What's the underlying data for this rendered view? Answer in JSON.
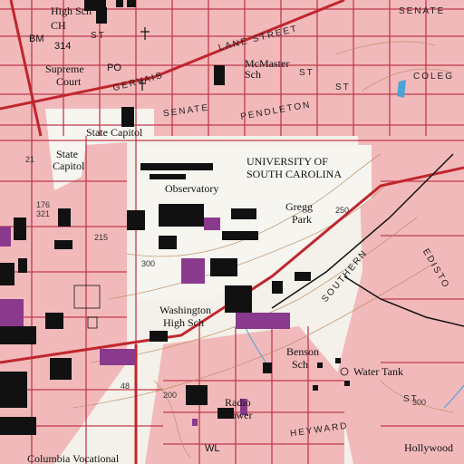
{
  "map": {
    "labels": {
      "high_sch": "High Sch",
      "ch": "CH",
      "bm": "BM",
      "bm_elev": "314",
      "st_top": "ST",
      "supreme_court_1": "Supreme",
      "supreme_court_2": "Court",
      "po": "PO",
      "gervais": "GERVAIS",
      "lane_street": "LANE STREET",
      "mcmaster_1": "McMaster",
      "mcmaster_2": "Sch",
      "senate_top": "SENATE",
      "senate_mid": "SENATE",
      "st_mid": "ST",
      "pendleton": "PENDLETON",
      "st_pend": "ST",
      "college": "COLEG",
      "state_capitol_1": "State Capitol",
      "state_capitol_2": "State",
      "state_capitol_3": "Capitol",
      "usc_1": "UNIVERSITY OF",
      "usc_2": "SOUTH CAROLINA",
      "observatory": "Observatory",
      "gregg_1": "Gregg",
      "gregg_2": "Park",
      "washington_1": "Washington",
      "washington_2": "High Sch",
      "southern": "SOUTHERN",
      "edisto": "EDISTO",
      "benson_1": "Benson",
      "benson_2": "Sch",
      "water_tank": "Water Tank",
      "radio_1": "Radio",
      "radio_2": "Tower",
      "heyward": "HEYWARD",
      "st_hey": "ST",
      "hollywood": "Hollywood",
      "columbia_vocational": "Columbia Vocational",
      "wl": "WL",
      "num_300a": "300",
      "num_300b": "300",
      "num_250": "250",
      "num_200": "200",
      "num_215": "215",
      "num_176": "176",
      "num_321": "321",
      "num_48": "48",
      "num_21": "21"
    },
    "colors": {
      "urban_tint": "#f2b9bb",
      "building": "#111111",
      "public_building": "#8a3a8c",
      "road_major": "#c0262d",
      "contour": "#b68a5c",
      "water": "#4aa3d6",
      "grid": "#c03a4a"
    }
  }
}
